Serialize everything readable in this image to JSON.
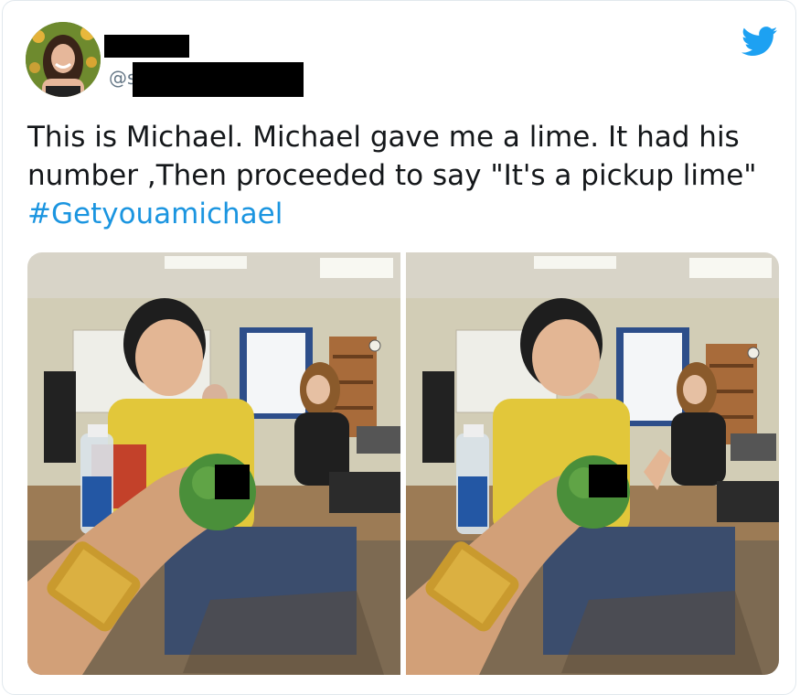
{
  "tweet": {
    "handle_prefix": "@s",
    "text": "This is Michael. Michael gave me a lime. It had his\nnumber ,Then proceeded to say \"It's a pickup lime\"",
    "hashtag": "#Getyouamichael",
    "brand_color": "#1da1f2",
    "hashtag_color": "#1b95e0"
  },
  "icons": {
    "brand": "twitter-bird-icon"
  },
  "media": {
    "photo_count": 2
  }
}
